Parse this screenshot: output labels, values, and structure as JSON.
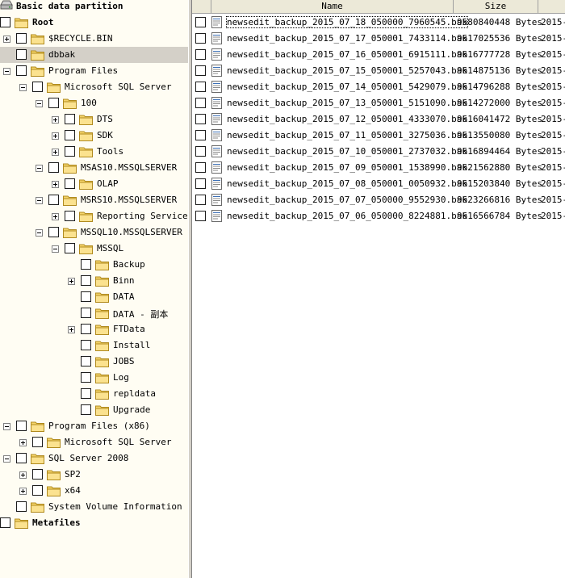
{
  "tree": {
    "partition_label": "Basic data partition",
    "items": [
      {
        "label": "Root",
        "bold": true
      },
      {
        "label": "$RECYCLE.BIN"
      },
      {
        "label": "dbbak",
        "selected": true
      },
      {
        "label": "Program Files"
      },
      {
        "label": "Microsoft SQL Server"
      },
      {
        "label": "100"
      },
      {
        "label": "DTS"
      },
      {
        "label": "SDK"
      },
      {
        "label": "Tools"
      },
      {
        "label": "MSAS10.MSSQLSERVER"
      },
      {
        "label": "OLAP"
      },
      {
        "label": "MSRS10.MSSQLSERVER"
      },
      {
        "label": "Reporting Services"
      },
      {
        "label": "MSSQL10.MSSQLSERVER"
      },
      {
        "label": "MSSQL"
      },
      {
        "label": "Backup"
      },
      {
        "label": "Binn"
      },
      {
        "label": "DATA"
      },
      {
        "label": "DATA - 副本"
      },
      {
        "label": "FTData"
      },
      {
        "label": "Install"
      },
      {
        "label": "JOBS"
      },
      {
        "label": "Log"
      },
      {
        "label": "repldata"
      },
      {
        "label": "Upgrade"
      },
      {
        "label": "Program Files (x86)"
      },
      {
        "label": "Microsoft SQL Server"
      },
      {
        "label": "SQL Server 2008"
      },
      {
        "label": "SP2"
      },
      {
        "label": "x64"
      },
      {
        "label": "System Volume Information"
      },
      {
        "label": "Metafiles",
        "bold": true
      }
    ]
  },
  "list": {
    "columns": {
      "name": "Name",
      "size": "Size"
    },
    "files": [
      {
        "name": "newsedit_backup_2015_07_18_050000_7960545.bak",
        "size": "9580840448 Bytes",
        "date": "2015-"
      },
      {
        "name": "newsedit_backup_2015_07_17_050001_7433114.bak",
        "size": "9617025536 Bytes",
        "date": "2015-"
      },
      {
        "name": "newsedit_backup_2015_07_16_050001_6915111.bak",
        "size": "9616777728 Bytes",
        "date": "2015-"
      },
      {
        "name": "newsedit_backup_2015_07_15_050001_5257043.bak",
        "size": "9614875136 Bytes",
        "date": "2015-"
      },
      {
        "name": "newsedit_backup_2015_07_14_050001_5429079.bak",
        "size": "9614796288 Bytes",
        "date": "2015-"
      },
      {
        "name": "newsedit_backup_2015_07_13_050001_5151090.bak",
        "size": "9614272000 Bytes",
        "date": "2015-"
      },
      {
        "name": "newsedit_backup_2015_07_12_050001_4333070.bak",
        "size": "9616041472 Bytes",
        "date": "2015-"
      },
      {
        "name": "newsedit_backup_2015_07_11_050001_3275036.bak",
        "size": "9613550080 Bytes",
        "date": "2015-"
      },
      {
        "name": "newsedit_backup_2015_07_10_050001_2737032.bak",
        "size": "9616894464 Bytes",
        "date": "2015-"
      },
      {
        "name": "newsedit_backup_2015_07_09_050001_1538990.bak",
        "size": "9621562880 Bytes",
        "date": "2015-"
      },
      {
        "name": "newsedit_backup_2015_07_08_050001_0050932.bak",
        "size": "9615203840 Bytes",
        "date": "2015-"
      },
      {
        "name": "newsedit_backup_2015_07_07_050000_9552930.bak",
        "size": "9623266816 Bytes",
        "date": "2015-"
      },
      {
        "name": "newsedit_backup_2015_07_06_050000_8224881.bak",
        "size": "9616566784 Bytes",
        "date": "2015-"
      }
    ]
  },
  "colors": {
    "tree_bg": "#fffdf3",
    "selected": "#d4d0c8",
    "folder": "#f5d469",
    "header": "#ece9d8"
  },
  "icons": {
    "partition": "drive-icon",
    "folder": "folder-icon",
    "file": "file-icon"
  }
}
